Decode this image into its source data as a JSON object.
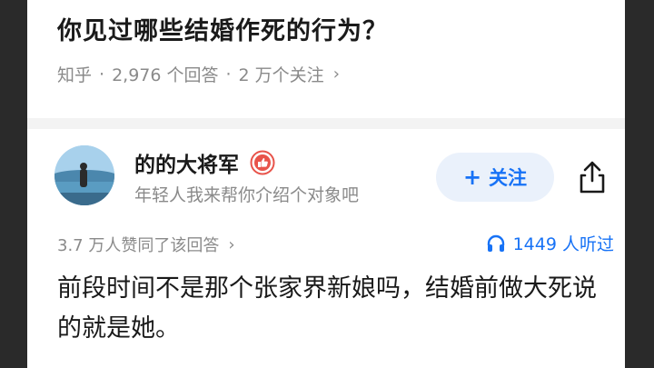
{
  "question": {
    "title": "你见过哪些结婚作死的行为？",
    "source": "知乎",
    "separator": "·",
    "answers_count": "2,976 个回答",
    "followers_count": "2 万个关注",
    "chevron": "›"
  },
  "author": {
    "name": "的的大将军",
    "bio": "年轻人我来帮你介绍个对象吧",
    "avatar_icon": "avatar-landscape-icon",
    "badge_icon": "like-badge-icon"
  },
  "actions": {
    "follow_plus": "+",
    "follow_label": "关注",
    "share_icon": "share-icon"
  },
  "answer": {
    "agree_text": "3.7 万人赞同了该回答",
    "chevron": "›",
    "listen_text": "1449 人听过",
    "listen_icon": "headphones-icon",
    "content": "前段时间不是那个张家界新娘吗，结婚前做大死说的就是她。"
  },
  "colors": {
    "accent": "#1772f6",
    "badge": "#e8534a",
    "muted": "#8a8a8a",
    "text": "#1a1a1a"
  }
}
